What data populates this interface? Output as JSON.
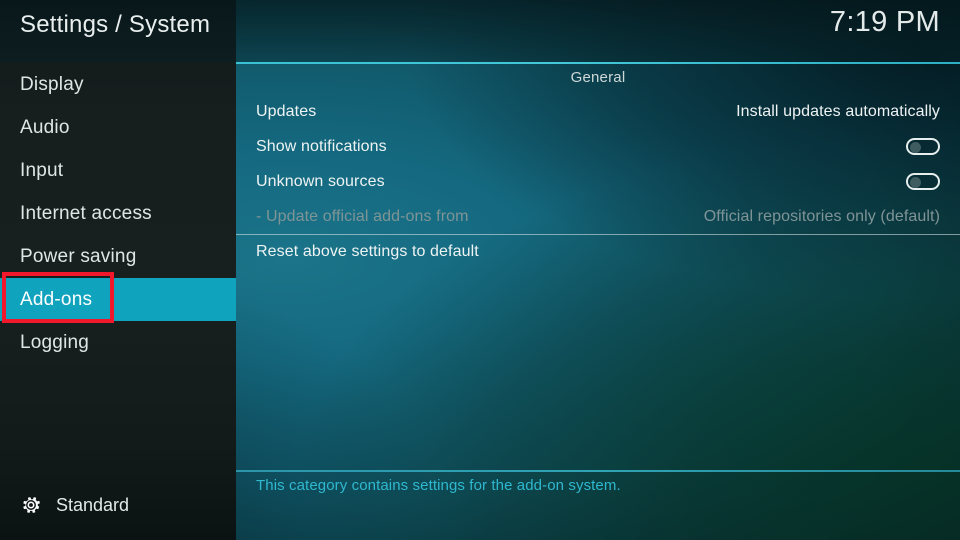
{
  "header": {
    "title": "Settings / System",
    "clock": "7:19 PM"
  },
  "sidebar": {
    "items": [
      {
        "label": "Display",
        "selected": false
      },
      {
        "label": "Audio",
        "selected": false
      },
      {
        "label": "Input",
        "selected": false
      },
      {
        "label": "Internet access",
        "selected": false
      },
      {
        "label": "Power saving",
        "selected": false
      },
      {
        "label": "Add-ons",
        "selected": true
      },
      {
        "label": "Logging",
        "selected": false
      }
    ],
    "footer": {
      "icon": "gear-icon",
      "label": "Standard"
    }
  },
  "content": {
    "section_title": "General",
    "rows": [
      {
        "label": "Updates",
        "value": "Install updates automatically",
        "control": "text",
        "disabled": false,
        "separator_above": false
      },
      {
        "label": "Show notifications",
        "value": "",
        "control": "toggle",
        "toggle_on": false,
        "disabled": false,
        "separator_above": false
      },
      {
        "label": "Unknown sources",
        "value": "",
        "control": "toggle",
        "toggle_on": false,
        "disabled": false,
        "separator_above": false
      },
      {
        "label": "- Update official add-ons from",
        "value": "Official repositories only (default)",
        "control": "text",
        "disabled": true,
        "separator_above": false
      },
      {
        "label": "Reset above settings to default",
        "value": "",
        "control": "none",
        "disabled": false,
        "separator_above": true
      }
    ]
  },
  "help": {
    "text": "This category contains settings for the add-on system."
  },
  "annotation": {
    "target": "Add-ons",
    "color": "#f2182c"
  },
  "colors": {
    "accent_selected": "#10a3bd",
    "accent_rule": "#3bc7da",
    "help_text": "#2fb8cf",
    "sidebar_bg": "#161e1e",
    "annotation": "#f2182c"
  }
}
